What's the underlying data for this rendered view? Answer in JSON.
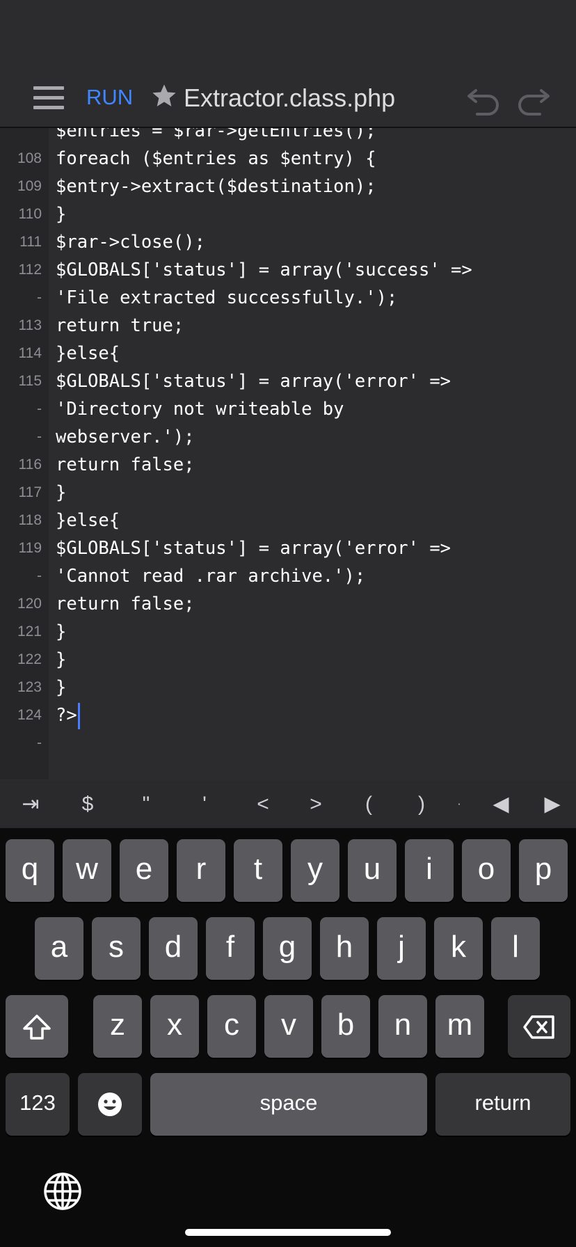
{
  "toolbar": {
    "run_label": "RUN",
    "file_name": "Extractor.class.php"
  },
  "editor": {
    "line_numbers": [
      "",
      "108",
      "109",
      "110",
      "111",
      "112",
      "-",
      "113",
      "114",
      "115",
      "-",
      "-",
      "116",
      "117",
      "118",
      "119",
      "-",
      "120",
      "121",
      "122",
      "123",
      "124",
      "-"
    ],
    "code_lines": [
      "$entries = $rar->getEntries();",
      "foreach ($entries as $entry) {",
      "$entry->extract($destination);",
      "}",
      "$rar->close();",
      "$GLOBALS['status'] = array('success' =>",
      "'File extracted successfully.');",
      "return true;",
      "}else{",
      "$GLOBALS['status'] = array('error' =>",
      "'Directory not writeable by",
      "webserver.');",
      "return false;",
      "}",
      "}else{",
      "$GLOBALS['status'] = array('error' =>",
      "'Cannot read .rar archive.');",
      "return false;",
      "}",
      "}",
      "}",
      "?>",
      ""
    ]
  },
  "accessory_keys": [
    "⇥",
    "$",
    "\"",
    "'",
    "<",
    ">",
    "(",
    ")",
    "·",
    "◀",
    "▶"
  ],
  "keyboard": {
    "row1": [
      "q",
      "w",
      "e",
      "r",
      "t",
      "y",
      "u",
      "i",
      "o",
      "p"
    ],
    "row2": [
      "a",
      "s",
      "d",
      "f",
      "g",
      "h",
      "j",
      "k",
      "l"
    ],
    "row3": [
      "z",
      "x",
      "c",
      "v",
      "b",
      "n",
      "m"
    ],
    "numbers_label": "123",
    "space_label": "space",
    "return_label": "return"
  },
  "colors": {
    "accent": "#3f86ff",
    "cursor": "#4a7dff",
    "background": "#2c2c2e",
    "keyboard_bg": "#0b0b0b",
    "key": "#5a5a5e"
  }
}
